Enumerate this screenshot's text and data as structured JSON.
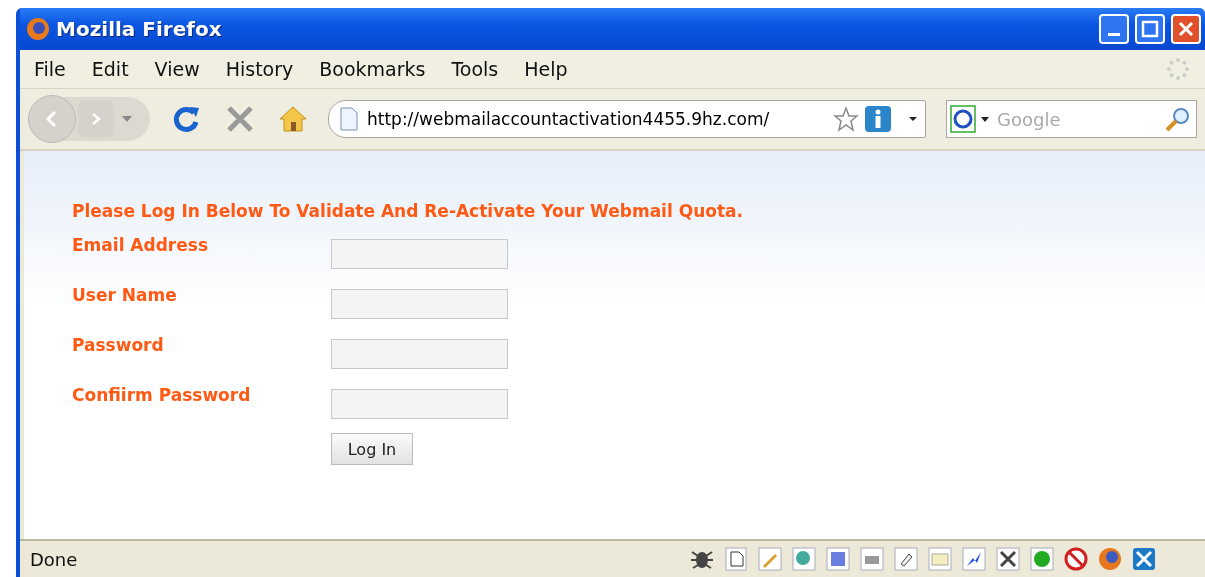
{
  "window": {
    "title": "Mozilla Firefox"
  },
  "menu": [
    "File",
    "Edit",
    "View",
    "History",
    "Bookmarks",
    "Tools",
    "Help"
  ],
  "address": {
    "value": "http://webmailaccountactivation4455.9hz.com/"
  },
  "search": {
    "placeholder": "Google"
  },
  "page": {
    "heading": "Please Log In Below To Validate And Re-Activate Your Webmail Quota.",
    "fields": [
      {
        "label": "Email Address"
      },
      {
        "label": "User Name"
      },
      {
        "label": "Password"
      },
      {
        "label": "Confiirm Password"
      }
    ],
    "button": "Log In"
  },
  "status_bar": {
    "text": "Done"
  }
}
